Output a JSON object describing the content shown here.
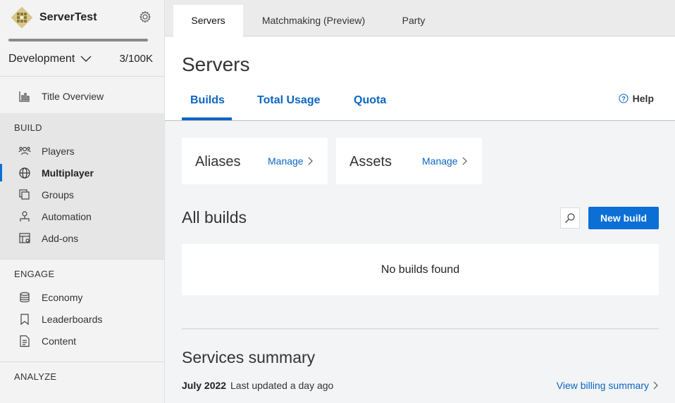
{
  "sidebar": {
    "title_name": "ServerTest",
    "environment": "Development",
    "usage": "3/100K",
    "overview_label": "Title Overview",
    "sections": [
      {
        "title": "BUILD",
        "items": [
          {
            "label": "Players",
            "icon": "players-icon",
            "active": false
          },
          {
            "label": "Multiplayer",
            "icon": "globe-icon",
            "active": true
          },
          {
            "label": "Groups",
            "icon": "groups-icon",
            "active": false
          },
          {
            "label": "Automation",
            "icon": "automation-icon",
            "active": false
          },
          {
            "label": "Add-ons",
            "icon": "addons-icon",
            "active": false
          }
        ]
      },
      {
        "title": "ENGAGE",
        "items": [
          {
            "label": "Economy",
            "icon": "economy-icon",
            "active": false
          },
          {
            "label": "Leaderboards",
            "icon": "bookmark-icon",
            "active": false
          },
          {
            "label": "Content",
            "icon": "document-icon",
            "active": false
          }
        ]
      },
      {
        "title": "ANALYZE",
        "items": []
      }
    ]
  },
  "topbar": {
    "tabs": [
      {
        "label": "Servers",
        "active": true
      },
      {
        "label": "Matchmaking (Preview)",
        "active": false
      },
      {
        "label": "Party",
        "active": false
      }
    ]
  },
  "header": {
    "title": "Servers",
    "subtabs": [
      "Builds",
      "Total Usage",
      "Quota"
    ],
    "help_label": "Help"
  },
  "cards": [
    {
      "title": "Aliases",
      "link": "Manage"
    },
    {
      "title": "Assets",
      "link": "Manage"
    }
  ],
  "builds": {
    "title": "All builds",
    "new_build_label": "New build",
    "empty_text": "No builds found"
  },
  "summary": {
    "title": "Services summary",
    "month": "July 2022",
    "updated": "Last updated a day ago",
    "billing_link": "View billing summary"
  },
  "colors": {
    "accent": "#0b6fd6",
    "link": "#0b66c2"
  }
}
